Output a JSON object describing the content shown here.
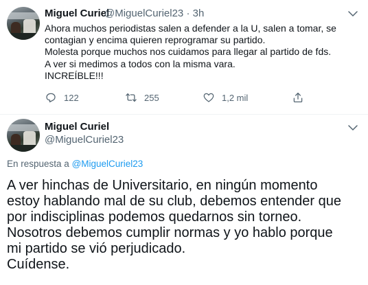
{
  "tweet1": {
    "author_name": "Miguel Curiel",
    "handle": "@MiguelCuriel23",
    "separator": " · ",
    "time": "3h",
    "lines": [
      "Ahora muchos periodistas salen a defender a la U, salen a tomar, se",
      "contagian y encima quieren reprogramar su partido.",
      "Molesta porque muchos nos cuidamos para llegar al partido de fds.",
      "A ver si medimos a todos con la misma vara.",
      "INCREÍBLE!!!"
    ],
    "replies": "122",
    "retweets": "255",
    "likes": "1,2 mil",
    "icons": [
      "chevron-down-icon",
      "reply-icon",
      "retweet-icon",
      "like-icon",
      "share-icon"
    ]
  },
  "tweet2": {
    "author_name": "Miguel Curiel",
    "handle": "@MiguelCuriel23",
    "reply_prefix": "En respuesta a ",
    "reply_to": "@MiguelCuriel23",
    "lines": [
      "A ver hinchas de Universitario, en ningún momento",
      "estoy hablando mal de su club, debemos entender que",
      "por indisciplinas podemos quedarnos sin torneo.",
      "Nosotros debemos cumplir normas y yo hablo porque",
      "mi partido se vió perjudicado.",
      "Cuídense."
    ]
  },
  "colors": {
    "text": "#0f1419",
    "muted": "#536471",
    "link": "#1d9bf0",
    "divider": "#eff3f4"
  }
}
